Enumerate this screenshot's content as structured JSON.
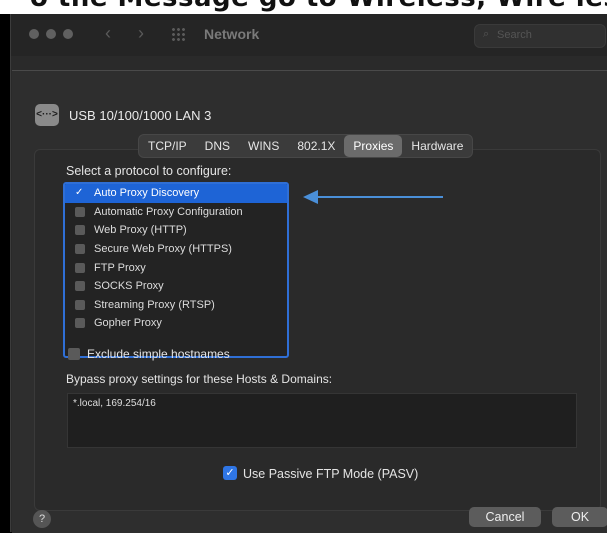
{
  "banner": {
    "text": "o the Message go to Wireless, Wire less"
  },
  "window": {
    "title": "Network",
    "search_placeholder": "Search"
  },
  "interface": {
    "icon_glyph": "<···>",
    "name": "USB 10/100/1000 LAN 3"
  },
  "tabs": [
    {
      "label": "TCP/IP"
    },
    {
      "label": "DNS"
    },
    {
      "label": "WINS"
    },
    {
      "label": "802.1X"
    },
    {
      "label": "Proxies",
      "active": true
    },
    {
      "label": "Hardware"
    }
  ],
  "proxies": {
    "prompt": "Select a protocol to configure:",
    "protocols": [
      {
        "label": "Auto Proxy Discovery",
        "checked": true,
        "selected": true
      },
      {
        "label": "Automatic Proxy Configuration",
        "checked": false
      },
      {
        "label": "Web Proxy (HTTP)",
        "checked": false
      },
      {
        "label": "Secure Web Proxy (HTTPS)",
        "checked": false
      },
      {
        "label": "FTP Proxy",
        "checked": false
      },
      {
        "label": "SOCKS Proxy",
        "checked": false
      },
      {
        "label": "Streaming Proxy (RTSP)",
        "checked": false
      },
      {
        "label": "Gopher Proxy",
        "checked": false
      }
    ],
    "exclude_simple_hostnames": "Exclude simple hostnames",
    "bypass_label": "Bypass proxy settings for these Hosts & Domains:",
    "bypass_value": "*.local, 169.254/16",
    "pasv_label": "Use Passive FTP Mode (PASV)",
    "pasv_checked": true
  },
  "buttons": {
    "help": "?",
    "cancel": "Cancel",
    "ok": "OK"
  },
  "colors": {
    "accent": "#1e64d6",
    "annotation_arrow": "#4a8fd8"
  },
  "icons": {
    "check": "check-icon",
    "help": "help-icon",
    "search": "search-icon"
  }
}
